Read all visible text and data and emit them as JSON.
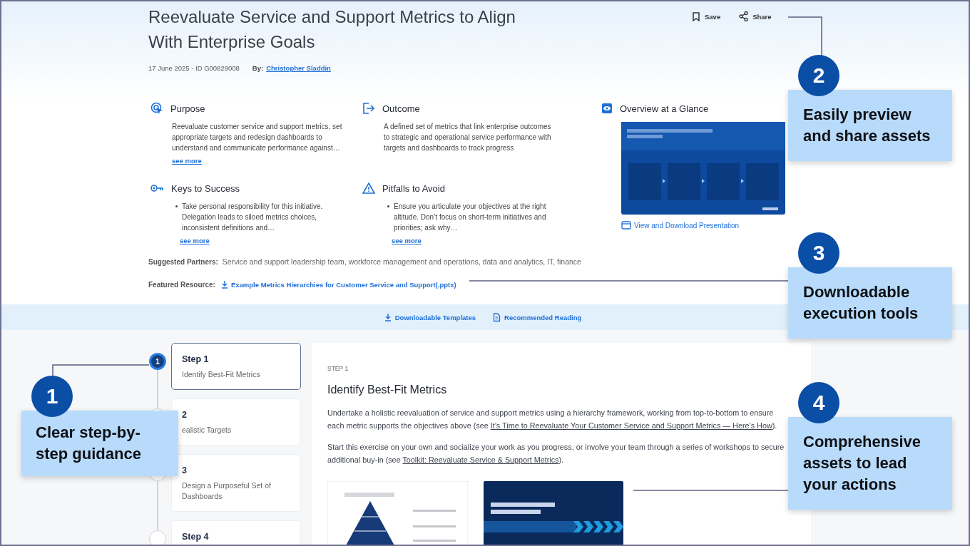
{
  "header": {
    "title": "Reevaluate Service and Support Metrics to Align With Enterprise Goals",
    "actions": [
      "Save",
      "Share"
    ],
    "date_id": "17 June 2025 - ID G00829008",
    "author_label": "By:",
    "author": "Christopher Sladdin"
  },
  "sections": [
    {
      "kind": "text",
      "heading": "Purpose",
      "text": "Reevaluate customer service and support metrics, set appropriate targets and redesign dashboards to understand and communicate performance against…",
      "more": "see more"
    },
    {
      "kind": "text",
      "heading": "Outcome",
      "text": "A defined set of metrics that link enterprise outcomes to strategic and operational service performance with targets and dashboards to track progress"
    },
    {
      "kind": "bullet",
      "heading": "Keys to Success",
      "text": "Take personal responsibility for this initiative. Delegation leads to siloed metrics choices, inconsistent definitions and…",
      "more": "see more"
    },
    {
      "kind": "bullet",
      "heading": "Pitfalls to Avoid",
      "text": "Ensure you articulate your objectives at the right altitude. Don’t focus on short-term initiatives and priorities; ask why…",
      "more": "see more"
    }
  ],
  "overview": {
    "heading": "Overview at a Glance",
    "image": {
      "kind": "picture"
    },
    "link": "View and Download Presentation"
  },
  "partners": {
    "label": "Suggested Partners:",
    "text": "Service and support leadership team, workforce management and operations, data and analytics, IT, finance"
  },
  "featured": {
    "label": "Featured Resource:",
    "link": "Example Metrics Hierarchies for Customer Service and Support(.pptx)"
  },
  "resource_links": [
    "Downloadable Templates",
    "Recommended Reading"
  ],
  "steps": [
    {
      "marker": "1",
      "label": "Step 1",
      "title": "Identify Best-Fit Metrics",
      "selected": true
    },
    {
      "label": "2",
      "title": "ealistic Targets",
      "selected": false
    },
    {
      "label": "3",
      "title": "Design a Purposeful Set of Dashboards",
      "selected": false
    },
    {
      "label": "Step 4",
      "selected": false
    }
  ],
  "step_detail": {
    "eyebrow": "STEP 1",
    "heading": "Identify Best-Fit Metrics",
    "paragraphs": [
      [
        {
          "kind": "text",
          "text": "Undertake a holistic reevaluation of service and support metrics using a hierarchy framework, working from top-to-bottom to ensure each metric supports the objectives above (see "
        },
        {
          "kind": "link",
          "text": "It’s Time to Reevaluate Your Customer Service and Support Metrics — Here’s How"
        },
        {
          "kind": "text",
          "text": ")."
        }
      ],
      [
        {
          "kind": "text",
          "text": "Start this exercise on your own and socialize your work as you progress, or involve your team through a series of workshops to secure additional buy-in (see "
        },
        {
          "kind": "link",
          "text": "Toolkit: Reevaluate Service & Support Metrics"
        },
        {
          "kind": "text",
          "text": ")."
        }
      ]
    ],
    "thumbnails": [
      {
        "kind": "picture"
      },
      {
        "kind": "picture"
      }
    ]
  },
  "callouts": [
    {
      "number": "1",
      "text": "Clear step-by-step guidance"
    },
    {
      "number": "2",
      "text": "Easily preview and share assets"
    },
    {
      "number": "3",
      "text": "Downloadable execution tools"
    },
    {
      "number": "4",
      "text": "Comprehensive assets to lead your actions"
    }
  ]
}
